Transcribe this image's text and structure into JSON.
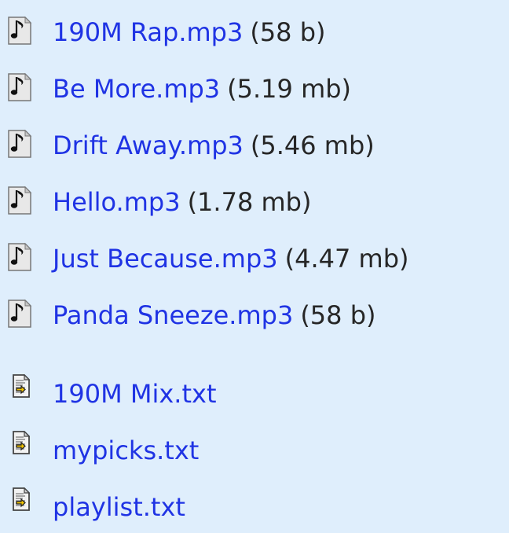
{
  "files": [
    {
      "name": "190M Rap.mp3",
      "size": "(58 b)",
      "icon": "music-file-icon"
    },
    {
      "name": "Be More.mp3",
      "size": "(5.19 mb)",
      "icon": "music-file-icon"
    },
    {
      "name": "Drift Away.mp3",
      "size": "(5.46 mb)",
      "icon": "music-file-icon"
    },
    {
      "name": "Hello.mp3",
      "size": "(1.78 mb)",
      "icon": "music-file-icon"
    },
    {
      "name": "Just Because.mp3",
      "size": "(4.47 mb)",
      "icon": "music-file-icon"
    },
    {
      "name": "Panda Sneeze.mp3",
      "size": "(58 b)",
      "icon": "music-file-icon"
    },
    {
      "name": "190M Mix.txt",
      "icon": "text-file-icon"
    },
    {
      "name": "mypicks.txt",
      "icon": "text-file-icon"
    },
    {
      "name": "playlist.txt",
      "icon": "text-file-icon"
    }
  ]
}
